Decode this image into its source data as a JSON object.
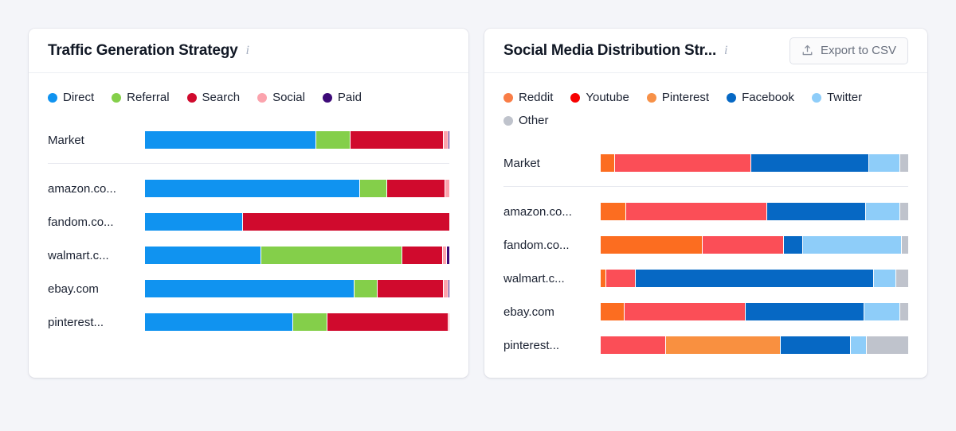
{
  "page": {
    "background": "#f4f5f9"
  },
  "left_card": {
    "title": "Traffic Generation Strategy",
    "info_icon": "i",
    "legend": [
      {
        "label": "Direct",
        "color": "#1093f0"
      },
      {
        "label": "Referral",
        "color": "#84cf4a"
      },
      {
        "label": "Search",
        "color": "#d00a2d"
      },
      {
        "label": "Social",
        "color": "#fba3ad"
      },
      {
        "label": "Paid",
        "color": "#3d0a78"
      }
    ],
    "chart_data": {
      "type": "bar",
      "orientation": "horizontal",
      "stacked": true,
      "normalized_percent": true,
      "title": "Traffic Generation Strategy",
      "xlabel": "",
      "ylabel": "",
      "xlim": [
        0,
        100
      ],
      "grid": false,
      "legend_position": "top-left",
      "categories": [
        "Market",
        "amazon.co...",
        "fandom.co...",
        "walmart.c...",
        "ebay.com",
        "pinterest..."
      ],
      "series": [
        {
          "name": "Direct",
          "color": "#1093f0",
          "values": [
            56.0,
            70.5,
            32.0,
            38.0,
            68.5,
            48.5
          ]
        },
        {
          "name": "Referral",
          "color": "#84cf4a",
          "values": [
            11.0,
            8.5,
            0.0,
            46.0,
            7.5,
            11.0
          ]
        },
        {
          "name": "Search",
          "color": "#d00a2d",
          "values": [
            30.5,
            19.0,
            68.0,
            13.0,
            21.5,
            39.5
          ]
        },
        {
          "name": "Social",
          "color": "#fba3ad",
          "values": [
            1.3,
            1.3,
            0.0,
            1.2,
            1.3,
            1.0
          ]
        },
        {
          "name": "Paid",
          "color": "#3d0a78",
          "values": [
            1.2,
            0.7,
            0.0,
            1.8,
            1.2,
            0.0
          ]
        }
      ]
    }
  },
  "right_card": {
    "title": "Social Media Distribution Str...",
    "info_icon": "i",
    "export_label": "Export to CSV",
    "export_icon": "upload-icon",
    "legend": [
      {
        "label": "Reddit",
        "color": "#f97d46"
      },
      {
        "label": "Youtube",
        "color": "#f70000"
      },
      {
        "label": "Pinterest",
        "color": "#f79148"
      },
      {
        "label": "Facebook",
        "color": "#0668c4"
      },
      {
        "label": "Twitter",
        "color": "#8ecdf9"
      },
      {
        "label": "Other",
        "color": "#bfc3cc"
      }
    ],
    "chart_data": {
      "type": "bar",
      "orientation": "horizontal",
      "stacked": true,
      "normalized_percent": true,
      "title": "Social Media Distribution Str...",
      "xlabel": "",
      "ylabel": "",
      "xlim": [
        0,
        100
      ],
      "grid": false,
      "legend_position": "top-left",
      "categories": [
        "Market",
        "amazon.co...",
        "fandom.co...",
        "walmart.c...",
        "ebay.com",
        "pinterest..."
      ],
      "series": [
        {
          "name": "Reddit",
          "color": "#fc6d20",
          "values": [
            4.5,
            8.0,
            33.0,
            1.5,
            7.5,
            0.0
          ]
        },
        {
          "name": "Youtube",
          "color": "#fb4e57",
          "values": [
            44.0,
            45.5,
            26.0,
            9.5,
            39.0,
            21.0
          ]
        },
        {
          "name": "Pinterest",
          "color": "#f99040",
          "values": [
            0.0,
            0.0,
            0.0,
            0.0,
            0.0,
            37.0
          ]
        },
        {
          "name": "Facebook",
          "color": "#0668c4",
          "values": [
            38.0,
            32.0,
            6.0,
            77.0,
            38.0,
            22.5
          ]
        },
        {
          "name": "Twitter",
          "color": "#8ecdf9",
          "values": [
            10.0,
            11.0,
            32.0,
            7.0,
            11.5,
            5.0
          ]
        },
        {
          "name": "Other",
          "color": "#bfc3cc",
          "values": [
            3.5,
            3.5,
            3.0,
            5.0,
            3.5,
            14.5
          ]
        }
      ]
    }
  }
}
